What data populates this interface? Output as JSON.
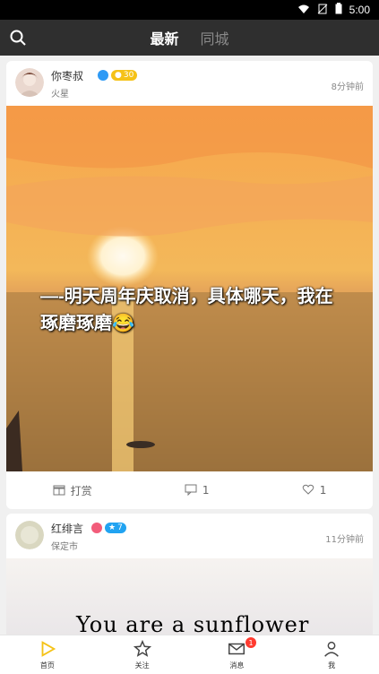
{
  "status": {
    "time": "5:00"
  },
  "appbar": {
    "tabs": [
      {
        "label": "最新",
        "active": true
      },
      {
        "label": "同城",
        "active": false
      }
    ]
  },
  "posts": [
    {
      "user": "你枣叔",
      "location": "火星",
      "time": "8分钟前",
      "level": "30",
      "image_text": "—-明天周年庆取消，具体哪天，我在琢磨琢磨😂",
      "actions": {
        "reward": "打赏",
        "comments": "1",
        "likes": "1"
      }
    },
    {
      "user": "红绯言",
      "location": "保定市",
      "time": "11分钟前",
      "level": "7",
      "image_text": "You are a sunflower"
    }
  ],
  "bottom_nav": {
    "home": "首页",
    "follow": "关注",
    "messages": "消息",
    "me": "我",
    "message_badge": "1"
  },
  "colors": {
    "accent": "#f5c217",
    "blue_badge": "#21a3f1",
    "notify": "#ff3b30"
  }
}
